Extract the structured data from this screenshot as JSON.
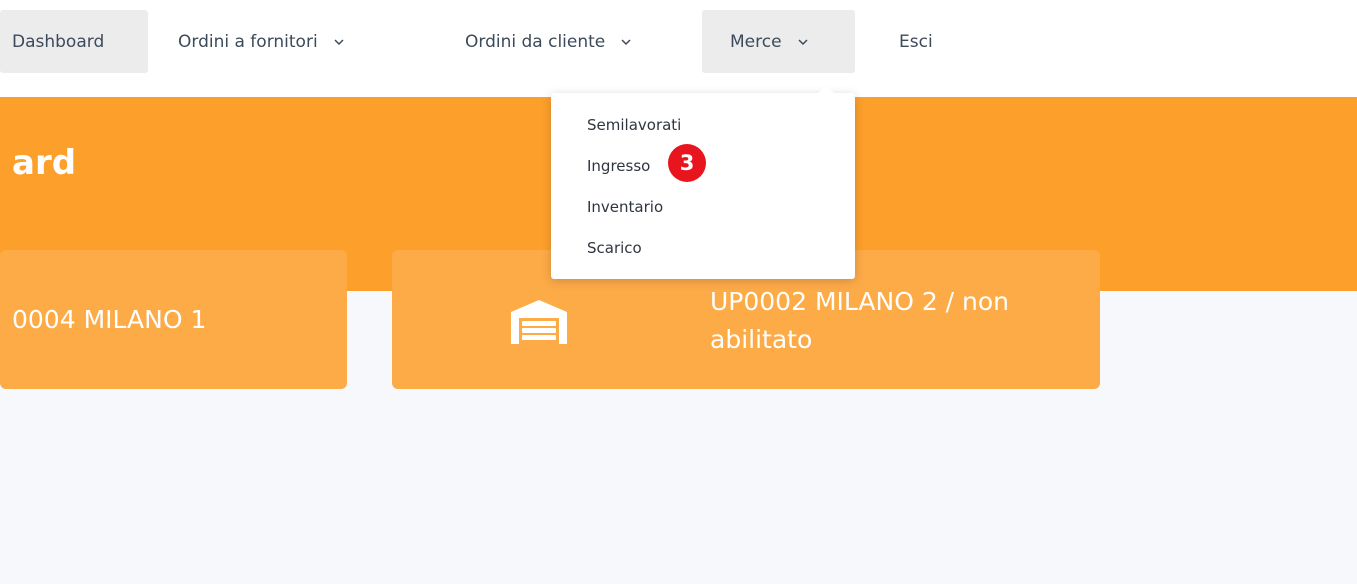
{
  "nav": {
    "dashboard": "Dashboard",
    "fornitori": "Ordini a fornitori",
    "cliente": "Ordini da cliente",
    "merce": "Merce",
    "esci": "Esci"
  },
  "dropdown": {
    "items": [
      {
        "label": "Semilavorati"
      },
      {
        "label": "Ingresso"
      },
      {
        "label": "Inventario"
      },
      {
        "label": "Scarico"
      }
    ]
  },
  "header": {
    "title": "ard"
  },
  "cards": [
    {
      "label": "0004 MILANO 1"
    },
    {
      "label": "UP0002 MILANO 2 / non abilitato",
      "icon": "warehouse-icon"
    }
  ],
  "step_badge": "3",
  "colors": {
    "accent": "#fd9f2b",
    "card": "#fdab47",
    "badge": "#e8141e"
  }
}
